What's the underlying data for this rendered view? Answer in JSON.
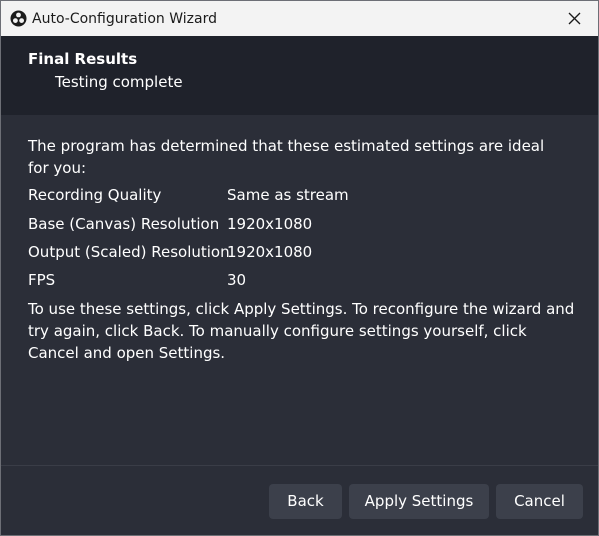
{
  "window": {
    "title": "Auto-Configuration Wizard"
  },
  "header": {
    "title": "Final Results",
    "subtitle": "Testing complete"
  },
  "content": {
    "intro": "The program has determined that these estimated settings are ideal for you:",
    "settings": [
      {
        "label": "Recording Quality",
        "value": "Same as stream"
      },
      {
        "label": "Base (Canvas) Resolution",
        "value": "1920x1080"
      },
      {
        "label": "Output (Scaled) Resolution",
        "value": "1920x1080"
      },
      {
        "label": "FPS",
        "value": "30"
      }
    ],
    "outro": "To use these settings, click Apply Settings. To reconfigure the wizard and try again, click Back. To manually configure settings yourself, click Cancel and open Settings."
  },
  "buttons": {
    "back": "Back",
    "apply": "Apply Settings",
    "cancel": "Cancel"
  },
  "icons": {
    "app": "obs-logo-icon",
    "close": "close-icon"
  },
  "colors": {
    "background": "#2b2e38",
    "header": "#1f222b",
    "button": "#3c404b",
    "titlebar": "#f3f3f3"
  }
}
